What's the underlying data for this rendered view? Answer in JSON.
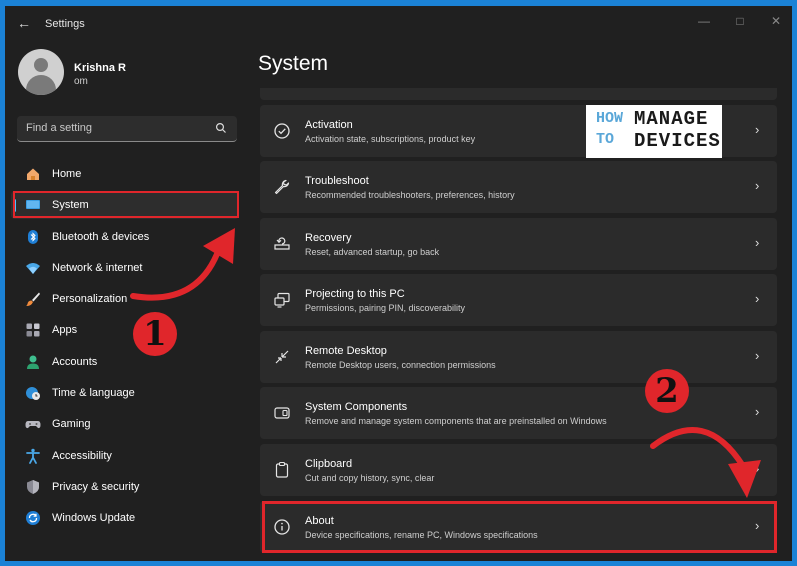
{
  "window": {
    "title": "Settings"
  },
  "user": {
    "name": "Krishna R",
    "email": "om"
  },
  "search": {
    "placeholder": "Find a setting"
  },
  "nav": [
    {
      "label": "Home",
      "icon": "home-icon"
    },
    {
      "label": "System",
      "icon": "system-monitor-icon",
      "selected": true
    },
    {
      "label": "Bluetooth & devices",
      "icon": "bluetooth-icon"
    },
    {
      "label": "Network & internet",
      "icon": "wifi-icon"
    },
    {
      "label": "Personalization",
      "icon": "brush-icon"
    },
    {
      "label": "Apps",
      "icon": "apps-icon"
    },
    {
      "label": "Accounts",
      "icon": "person-icon"
    },
    {
      "label": "Time & language",
      "icon": "globe-clock-icon"
    },
    {
      "label": "Gaming",
      "icon": "gamepad-icon"
    },
    {
      "label": "Accessibility",
      "icon": "accessibility-icon"
    },
    {
      "label": "Privacy & security",
      "icon": "shield-icon"
    },
    {
      "label": "Windows Update",
      "icon": "update-icon"
    }
  ],
  "main": {
    "title": "System",
    "cards": [
      {
        "title": "Activation",
        "subtitle": "Activation state, subscriptions, product key",
        "icon": "check-circle-icon"
      },
      {
        "title": "Troubleshoot",
        "subtitle": "Recommended troubleshooters, preferences, history",
        "icon": "wrench-icon"
      },
      {
        "title": "Recovery",
        "subtitle": "Reset, advanced startup, go back",
        "icon": "recovery-icon"
      },
      {
        "title": "Projecting to this PC",
        "subtitle": "Permissions, pairing PIN, discoverability",
        "icon": "projector-icon"
      },
      {
        "title": "Remote Desktop",
        "subtitle": "Remote Desktop users, connection permissions",
        "icon": "remote-desktop-icon"
      },
      {
        "title": "System Components",
        "subtitle": "Remove and manage system components that are preinstalled on Windows",
        "icon": "components-icon"
      },
      {
        "title": "Clipboard",
        "subtitle": "Cut and copy history, sync, clear",
        "icon": "clipboard-icon"
      },
      {
        "title": "About",
        "subtitle": "Device specifications, rename PC, Windows specifications",
        "icon": "info-icon"
      }
    ]
  },
  "watermark": {
    "line1a": "HOW",
    "line1b": "MANAGE",
    "line2a": "TO",
    "line2b": "DEVICES"
  },
  "annotations": {
    "step1": "1",
    "step2": "2"
  },
  "colors": {
    "accent": "#4cc2ff",
    "annotation": "#e0262b",
    "background": "#202020",
    "card": "#2b2b2b"
  }
}
